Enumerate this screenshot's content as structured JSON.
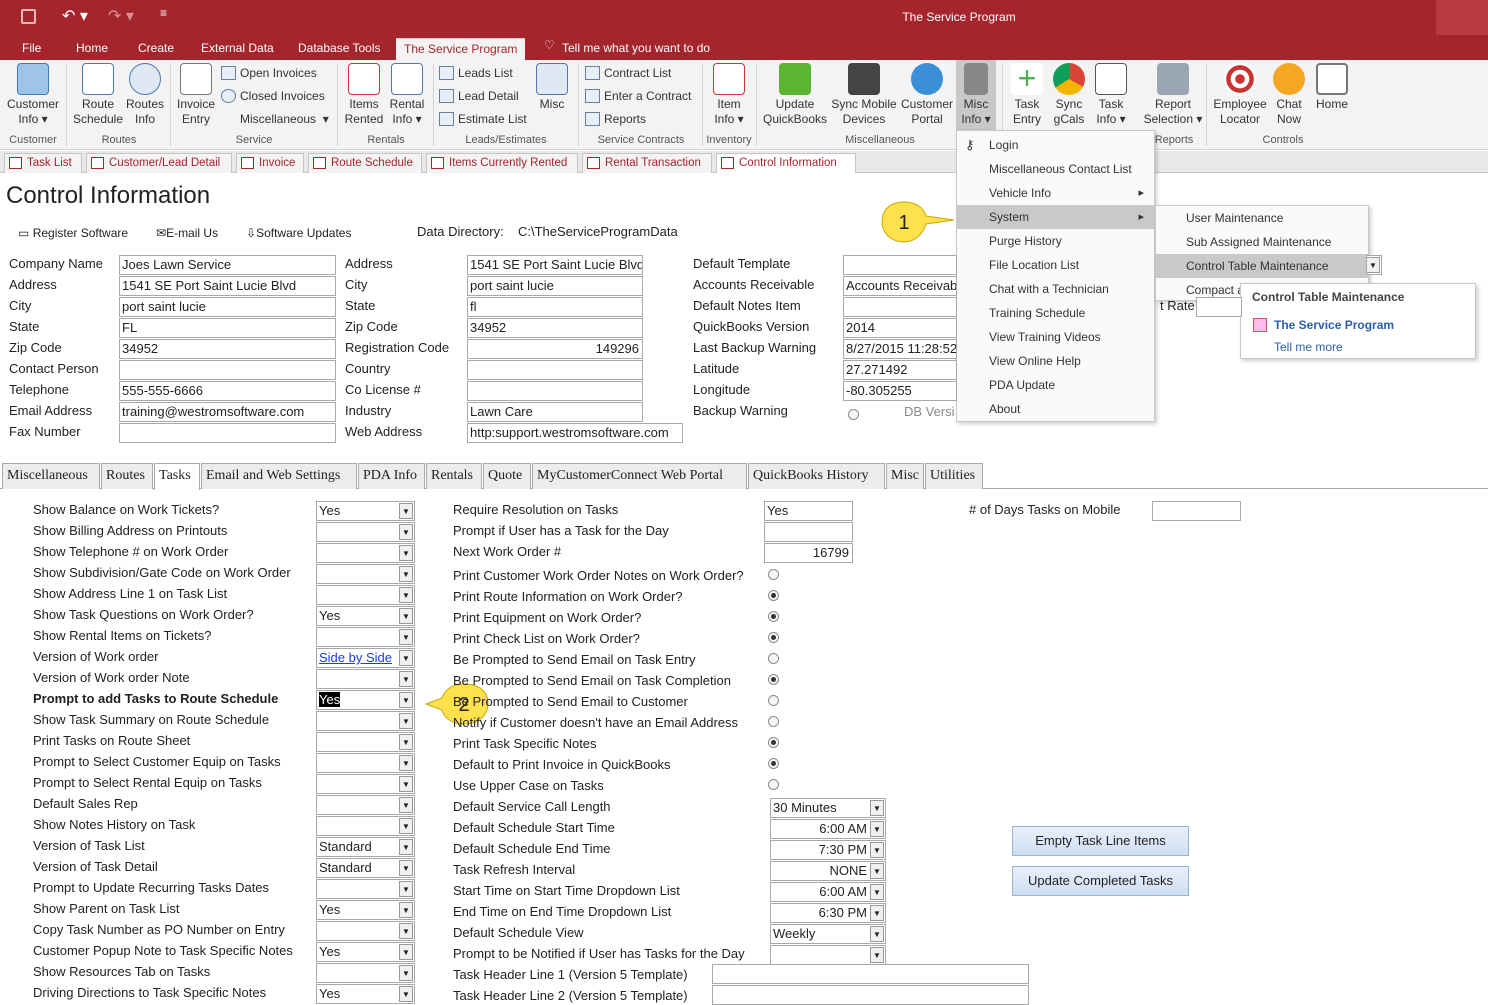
{
  "app": {
    "title": "The Service Program"
  },
  "menu": {
    "file": "File",
    "home": "Home",
    "create": "Create",
    "external": "External Data",
    "dbtools": "Database Tools",
    "program": "The Service Program",
    "tell": "Tell me what you want to do"
  },
  "ribbon": {
    "customer_info": "Customer Info",
    "route_schedule": "Route Schedule",
    "routes_info": "Routes Info",
    "invoice_entry": "Invoice Entry",
    "open_invoices": "Open Invoices",
    "closed_invoices": "Closed Invoices",
    "miscellaneous": "Miscellaneous",
    "items_rented": "Items Rented",
    "rental_info": "Rental Info",
    "leads_list": "Leads List",
    "lead_detail": "Lead Detail",
    "estimate_list": "Estimate List",
    "misc": "Misc",
    "contract_list": "Contract List",
    "enter_contract": "Enter a Contract",
    "reports": "Reports",
    "item_info": "Item Info",
    "update_qb": "Update QuickBooks",
    "sync_mobile": "Sync Mobile Devices",
    "customer_portal": "Customer Portal",
    "misc_info": "Misc Info",
    "task_entry": "Task Entry",
    "sync_gcals": "Sync gCals",
    "task_info": "Task Info",
    "report_selection": "Report Selection",
    "employee_locator": "Employee Locator",
    "chat_now": "Chat Now",
    "home": "Home",
    "groups": {
      "customer": "Customer",
      "routes": "Routes",
      "service": "Service",
      "rentals": "Rentals",
      "leads": "Leads/Estimates",
      "contracts": "Service Contracts",
      "inventory": "Inventory",
      "miscellaneous": "Miscellaneous",
      "reports": "Reports",
      "controls": "Controls"
    }
  },
  "doctabs": [
    "Task List",
    "Customer/Lead Detail",
    "Invoice",
    "Route Schedule",
    "Items Currently Rented",
    "Rental Transaction",
    "Control Information"
  ],
  "page": {
    "title": "Control Information",
    "register": "Register Software",
    "email_us": "E-mail Us",
    "updates": "Software Updates",
    "data_dir_label": "Data Directory:",
    "data_dir": "C:\\TheServiceProgramData"
  },
  "company": {
    "labels": [
      "Company Name",
      "Address",
      "City",
      "State",
      "Zip Code",
      "Contact Person",
      "Telephone",
      "Email Address",
      "Fax Number"
    ],
    "values": [
      "Joes Lawn Service",
      "1541 SE Port Saint Lucie Blvd",
      "port saint lucie",
      "FL",
      "34952",
      "",
      "555-555-6666",
      "training@westromsoftware.com",
      ""
    ]
  },
  "reg": {
    "labels": [
      "Address",
      "City",
      "State",
      "Zip Code",
      "Registration Code",
      "Country",
      "Co License #",
      "Industry",
      "Web Address"
    ],
    "values": [
      "1541 SE Port Saint Lucie Blvd",
      "port saint lucie",
      "fl",
      "34952",
      "149296",
      "",
      "",
      "Lawn Care",
      "http:support.westromsoftware.com"
    ]
  },
  "defaults": {
    "labels": [
      "Default Template",
      "Accounts Receivable",
      "Default Notes Item",
      "QuickBooks Version",
      "Last Backup Warning",
      "Latitude",
      "Longitude",
      "Backup Warning"
    ],
    "values": [
      "",
      "Accounts Receivable",
      "",
      "2014",
      "8/27/2015 11:28:52",
      "27.271492",
      "-80.305255"
    ],
    "db_version": "DB Versi",
    "tax_rate": "t Rate"
  },
  "ctabs": [
    "Miscellaneous",
    "Routes",
    "Tasks",
    "Email and Web Settings",
    "PDA Info",
    "Rentals",
    "Quote",
    "MyCustomerConnect Web Portal",
    "QuickBooks History",
    "Misc",
    "Utilities"
  ],
  "tasks_left": [
    [
      "Show Balance on Work Tickets?",
      "Yes"
    ],
    [
      "Show Billing Address on Printouts",
      ""
    ],
    [
      "Show Telephone # on Work Order",
      ""
    ],
    [
      "Show Subdivision/Gate Code on Work Order",
      ""
    ],
    [
      "Show Address Line 1 on Task List",
      ""
    ],
    [
      "Show Task Questions on Work Order?",
      "Yes"
    ],
    [
      "Show Rental Items on Tickets?",
      ""
    ],
    [
      "Version of Work order",
      "Side by Side"
    ],
    [
      "Version of Work order Note",
      ""
    ],
    [
      "Prompt to add Tasks to Route Schedule",
      "Yes"
    ],
    [
      "Show Task Summary on Route Schedule",
      ""
    ],
    [
      "Print Tasks on Route Sheet",
      ""
    ],
    [
      "Prompt to Select Customer Equip on Tasks",
      ""
    ],
    [
      "Prompt to Select Rental  Equip on Tasks",
      ""
    ],
    [
      "Default Sales Rep",
      ""
    ],
    [
      "Show Notes History on Task",
      ""
    ],
    [
      "Version of Task List",
      "Standard"
    ],
    [
      "Version of Task Detail",
      "Standard"
    ],
    [
      "Prompt to Update Recurring Tasks Dates",
      ""
    ],
    [
      "Show Parent on Task List",
      "Yes"
    ],
    [
      "Copy Task Number as PO Number on Entry",
      ""
    ],
    [
      "Customer Popup Note to Task Specific Notes",
      "Yes"
    ],
    [
      "Show Resources Tab on Tasks",
      ""
    ],
    [
      "Driving Directions to Task Specific Notes",
      "Yes"
    ]
  ],
  "tasks_mid_top": [
    [
      "Require Resolution on Tasks",
      "Yes"
    ],
    [
      "Prompt if User has a Task for the Day",
      ""
    ],
    [
      "Next Work Order #",
      "16799"
    ]
  ],
  "tasks_radios": [
    [
      "Print Customer Work Order Notes on Work Order?",
      false
    ],
    [
      "Print Route Information on Work Order?",
      true
    ],
    [
      "Print Equipment on Work Order?",
      true
    ],
    [
      "Print Check List on Work Order?",
      true
    ],
    [
      "Be Prompted to Send Email on Task Entry",
      false
    ],
    [
      "Be Prompted to Send Email on Task Completion",
      true
    ],
    [
      "Be Prompted to Send Email to Customer",
      false
    ],
    [
      "Notify if Customer doesn't have an Email Address",
      false
    ],
    [
      "Print Task Specific Notes",
      true
    ],
    [
      "Default to Print Invoice in QuickBooks",
      true
    ],
    [
      "Use Upper Case on Tasks",
      false
    ]
  ],
  "tasks_mid_bottom": [
    [
      "Default Service Call Length",
      "30 Minutes"
    ],
    [
      "Default Schedule Start Time",
      "6:00 AM"
    ],
    [
      "Default Schedule End Time",
      "7:30 PM"
    ],
    [
      "Task Refresh Interval",
      "NONE"
    ],
    [
      "Start Time on Start Time Dropdown List",
      "6:00 AM"
    ],
    [
      "End Time on End Time Dropdown List",
      "6:30 PM"
    ],
    [
      "Default Schedule View",
      "Weekly"
    ],
    [
      "Prompt to be Notified if User has Tasks for the Day",
      ""
    ],
    [
      "Task Header Line 1 (Version 5 Template)",
      ""
    ],
    [
      "Task Header Line 2 (Version 5 Template)",
      ""
    ]
  ],
  "days_label": "# of Days Tasks on Mobile",
  "buttons": {
    "empty": "Empty Task Line Items",
    "update": "Update Completed Tasks"
  },
  "misc_menu": [
    "Login",
    "Miscellaneous Contact List",
    "Vehicle Info",
    "System",
    "Purge History",
    "File Location List",
    "Chat with a Technician",
    "Training Schedule",
    "View Training Videos",
    "View Online Help",
    "PDA Update",
    "About"
  ],
  "sub_menu": [
    "User Maintenance",
    "Sub Assigned Maintenance",
    "Control Table Maintenance",
    "Compact a"
  ],
  "tooltip": {
    "title": "Control Table Maintenance",
    "app": "The Service Program",
    "more": "Tell me more"
  },
  "callouts": [
    "1",
    "2"
  ]
}
